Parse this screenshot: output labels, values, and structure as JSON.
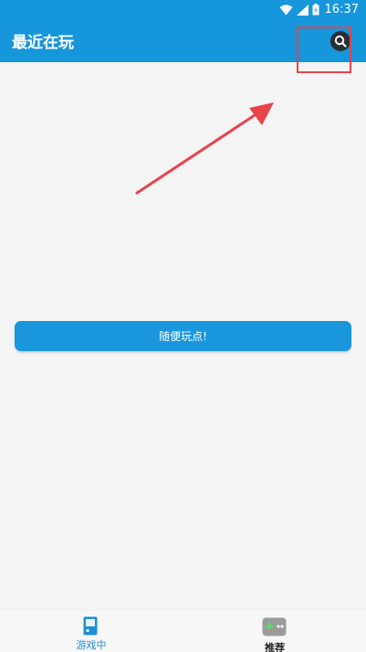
{
  "status_bar": {
    "time": "16:37",
    "icons": [
      "wifi-icon",
      "signal-icon",
      "battery-icon"
    ]
  },
  "app_bar": {
    "title": "最近在玩",
    "search_icon": "search-icon"
  },
  "annotation": {
    "highlight_color": "#e8434a",
    "arrow_color": "#e8434a"
  },
  "main": {
    "random_play_label": "随便玩点!"
  },
  "bottom_nav": {
    "items": [
      {
        "label": "游戏中",
        "icon": "handheld-console-icon",
        "active": true
      },
      {
        "label": "推荐",
        "icon": "gamepad-icon",
        "active": false
      }
    ]
  },
  "colors": {
    "primary": "#1696db",
    "background": "#f4f4f4",
    "active_tab": "#1e8fd6"
  }
}
